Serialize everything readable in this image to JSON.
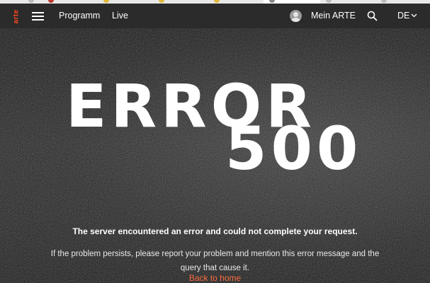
{
  "nav": {
    "logo_text": "arte",
    "program_label": "Programm",
    "live_label": "Live",
    "account_label": "Mein ARTE",
    "language_label": "DE"
  },
  "error": {
    "word": "ERROR",
    "code": "500",
    "message": "The server encountered an error and could not complete your request.",
    "detail": "If the problem persists, please report your problem and mention this error message and the query that cause it.",
    "back_label": "Back to home"
  },
  "colors": {
    "brand": "#fa481c",
    "link": "#fa6b3d",
    "navbar": "#2b2b2b",
    "background": "#111111"
  },
  "icons": [
    "hamburger-menu-icon",
    "user-avatar-icon",
    "search-icon",
    "chevron-down-icon"
  ]
}
